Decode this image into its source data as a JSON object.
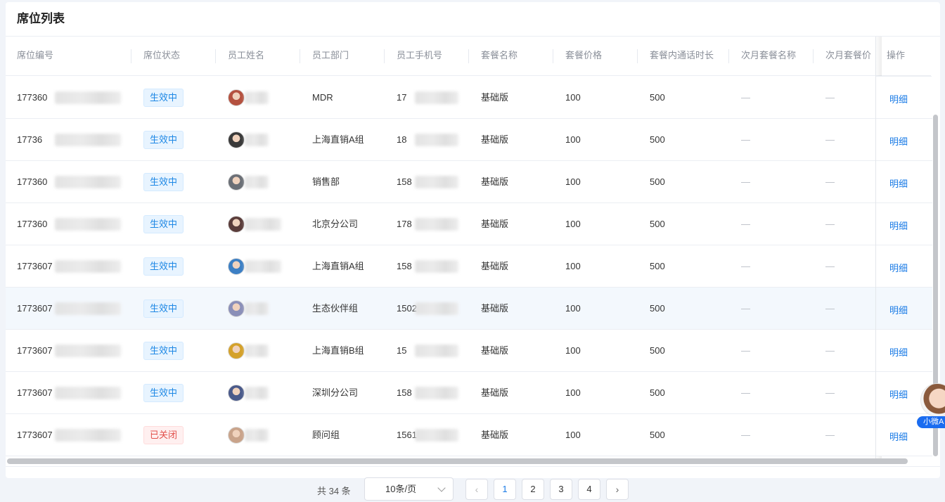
{
  "card": {
    "title": "席位列表"
  },
  "columns": [
    {
      "key": "seat_no",
      "label": "席位编号"
    },
    {
      "key": "status",
      "label": "席位状态"
    },
    {
      "key": "name",
      "label": "员工姓名"
    },
    {
      "key": "dept",
      "label": "员工部门"
    },
    {
      "key": "phone",
      "label": "员工手机号"
    },
    {
      "key": "plan",
      "label": "套餐名称"
    },
    {
      "key": "price",
      "label": "套餐价格"
    },
    {
      "key": "minutes",
      "label": "套餐内通话时长"
    },
    {
      "key": "next_plan",
      "label": "次月套餐名称"
    },
    {
      "key": "next_price",
      "label": "次月套餐价"
    },
    {
      "key": "action",
      "label": "操作"
    }
  ],
  "rows": [
    {
      "seat_no": "177360",
      "status": "生效中",
      "status_type": "active",
      "name": "",
      "dept": "MDR",
      "phone": "17",
      "plan": "基础版",
      "price": "100",
      "minutes": "500",
      "next_plan": "—",
      "next_price": "—",
      "action": "明细"
    },
    {
      "seat_no": "17736",
      "status": "生效中",
      "status_type": "active",
      "name": "",
      "dept": "上海直销A组",
      "phone": "18",
      "plan": "基础版",
      "price": "100",
      "minutes": "500",
      "next_plan": "—",
      "next_price": "—",
      "action": "明细"
    },
    {
      "seat_no": "177360",
      "status": "生效中",
      "status_type": "active",
      "name": "",
      "dept": "销售部",
      "phone": "158",
      "plan": "基础版",
      "price": "100",
      "minutes": "500",
      "next_plan": "—",
      "next_price": "—",
      "action": "明细"
    },
    {
      "seat_no": "177360",
      "status": "生效中",
      "status_type": "active",
      "name": "",
      "dept": "北京分公司",
      "phone": "178",
      "plan": "基础版",
      "price": "100",
      "minutes": "500",
      "next_plan": "—",
      "next_price": "—",
      "action": "明细"
    },
    {
      "seat_no": "1773607",
      "status": "生效中",
      "status_type": "active",
      "name": "",
      "dept": "上海直销A组",
      "phone": "158",
      "plan": "基础版",
      "price": "100",
      "minutes": "500",
      "next_plan": "—",
      "next_price": "—",
      "action": "明细"
    },
    {
      "seat_no": "1773607",
      "status": "生效中",
      "status_type": "active",
      "name": "",
      "dept": "生态伙伴组",
      "phone": "1502",
      "plan": "基础版",
      "price": "100",
      "minutes": "500",
      "next_plan": "—",
      "next_price": "—",
      "action": "明细"
    },
    {
      "seat_no": "1773607",
      "status": "生效中",
      "status_type": "active",
      "name": "",
      "dept": "上海直销B组",
      "phone": "15",
      "plan": "基础版",
      "price": "100",
      "minutes": "500",
      "next_plan": "—",
      "next_price": "—",
      "action": "明细"
    },
    {
      "seat_no": "1773607",
      "status": "生效中",
      "status_type": "active",
      "name": "",
      "dept": "深圳分公司",
      "phone": "158",
      "plan": "基础版",
      "price": "100",
      "minutes": "500",
      "next_plan": "—",
      "next_price": "—",
      "action": "明细"
    },
    {
      "seat_no": "1773607",
      "status": "已关闭",
      "status_type": "closed",
      "name": "",
      "dept": "顾问组",
      "phone": "1561",
      "plan": "基础版",
      "price": "100",
      "minutes": "500",
      "next_plan": "—",
      "next_price": "—",
      "action": "明细"
    }
  ],
  "avatars": [
    "#b4513f",
    "#3a3a3a",
    "#6b6f76",
    "#5a3c3a",
    "#3c7fc4",
    "#8a8fb8",
    "#d4a12a",
    "#4a5a8a",
    "#c9a38a"
  ],
  "colors": {
    "accent": "#1a7be6",
    "active_tag": "#1e88e5",
    "closed_tag": "#e2504b",
    "highlight_row": "#f3f8fd"
  },
  "pagination": {
    "total_text": "共 34 条",
    "page_size": "10条/页",
    "prev": "‹",
    "next": "›",
    "pages": [
      "1",
      "2",
      "3",
      "4"
    ],
    "current": "1"
  },
  "assistant": {
    "label": "小微A"
  }
}
